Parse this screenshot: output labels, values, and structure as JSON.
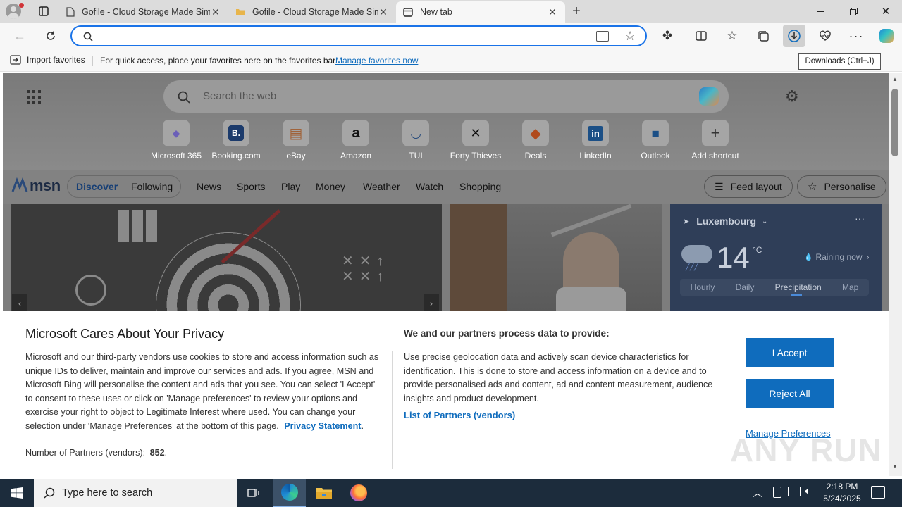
{
  "tabs": [
    {
      "title": "Gofile - Cloud Storage Made Sim"
    },
    {
      "title": "Gofile - Cloud Storage Made Sim"
    },
    {
      "title": "New tab"
    }
  ],
  "favbar": {
    "import_label": "Import favorites",
    "hint": "For quick access, place your favorites here on the favorites bar.",
    "manage_link": "Manage favorites now"
  },
  "tooltip": "Downloads (Ctrl+J)",
  "newtab": {
    "search_placeholder": "Search the web",
    "shortcuts": [
      {
        "label": "Microsoft 365",
        "glyph": "◆"
      },
      {
        "label": "Booking.com",
        "glyph": "B."
      },
      {
        "label": "eBay",
        "glyph": "▤"
      },
      {
        "label": "Amazon",
        "glyph": "a"
      },
      {
        "label": "TUI",
        "glyph": "◡"
      },
      {
        "label": "Forty Thieves",
        "glyph": "✕"
      },
      {
        "label": "Deals",
        "glyph": "◆"
      },
      {
        "label": "LinkedIn",
        "glyph": "in"
      },
      {
        "label": "Outlook",
        "glyph": "◼"
      },
      {
        "label": "Add shortcut",
        "glyph": "+"
      }
    ]
  },
  "msn": {
    "logo": "msn",
    "discover": "Discover",
    "following": "Following",
    "nav": [
      "News",
      "Sports",
      "Play",
      "Money",
      "Weather",
      "Watch",
      "Shopping"
    ],
    "feed_layout": "Feed layout",
    "personalise": "Personalise"
  },
  "weather": {
    "location": "Luxembourg",
    "temp": "14",
    "unit": "°C",
    "condition": "Raining now",
    "tabs": [
      "Hourly",
      "Daily",
      "Precipitation",
      "Map"
    ]
  },
  "consent": {
    "title": "Microsoft Cares About Your Privacy",
    "body": "Microsoft and our third-party vendors use cookies to store and access information such as unique IDs to deliver, maintain and improve our services and ads. If you agree, MSN and Microsoft Bing will personalise the content and ads that you see. You can select 'I Accept' to consent to these uses or click on 'Manage preferences' to review your options and exercise your right to object to Legitimate Interest where used.  You can change your selection under 'Manage Preferences' at the bottom of this page.",
    "privacy_link": "Privacy Statement",
    "partners_label": "Number of Partners (vendors):",
    "partners_count": "852",
    "right_title": "We and our partners process data to provide:",
    "right_body": "Use precise geolocation data and actively scan device characteristics for identification. This is done to store and access information on a device and to provide personalised ads and content, ad and content measurement, audience insights and product development.",
    "vendors_link": "List of Partners (vendors)",
    "accept": "I Accept",
    "reject": "Reject All",
    "manage": "Manage Preferences"
  },
  "watermark": "ANY RUN",
  "taskbar": {
    "search_placeholder": "Type here to search",
    "time": "2:18 PM",
    "date": "5/24/2025"
  },
  "colors": {
    "accent": "#0f6cbd",
    "address_focus": "#1a73e8",
    "taskbar": "#1c2c3c"
  }
}
